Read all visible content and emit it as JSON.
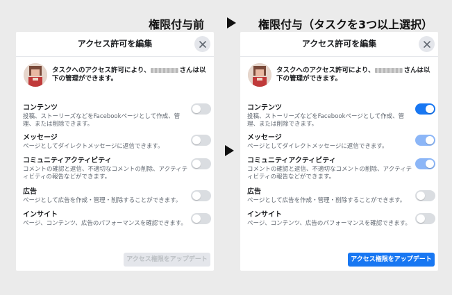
{
  "headings": {
    "before": "権限付与前",
    "after": "権限付与（タスクを3つ以上選択）"
  },
  "dialog_before": {
    "title": "アクセス許可を編集",
    "intro_prefix": "タスクへのアクセス許可により、",
    "intro_suffix": "さんは以下の管理ができます。",
    "permissions": [
      {
        "label": "コンテンツ",
        "desc": "投稿、ストーリーズなどをFacebookページとして作成、管理、または削除できます。",
        "state": "off"
      },
      {
        "label": "メッセージ",
        "desc": "ページとしてダイレクトメッセージに返信できます。",
        "state": "off"
      },
      {
        "label": "コミュニティアクティビティ",
        "desc": "コメントの確認と返信、不適切なコメントの削除、アクティティビティの報告などができます。",
        "state": "off"
      },
      {
        "label": "広告",
        "desc": "ページとして広告を作成・管理・削除することができます。",
        "state": "off"
      },
      {
        "label": "インサイト",
        "desc": "ページ、コンテンツ、広告のパフォーマンスを確認できます。",
        "state": "off"
      }
    ],
    "update_button": "アクセス権限をアップデート",
    "update_enabled": false
  },
  "dialog_after": {
    "title": "アクセス許可を編集",
    "intro_prefix": "タスクへのアクセス許可により、",
    "intro_suffix": "さんは以下の管理ができます。",
    "permissions": [
      {
        "label": "コンテンツ",
        "desc": "投稿、ストーリーズなどをFacebookページとして作成、管理、または削除できます。",
        "state": "on"
      },
      {
        "label": "メッセージ",
        "desc": "ページとしてダイレクトメッセージに返信できます。",
        "state": "on-dim"
      },
      {
        "label": "コミュニティアクティビティ",
        "desc": "コメントの確認と返信、不適切なコメントの削除、アクティティビティの報告などができます。",
        "state": "on-dim"
      },
      {
        "label": "広告",
        "desc": "ページとして広告を作成・管理・削除することができます。",
        "state": "off"
      },
      {
        "label": "インサイト",
        "desc": "ページ、コンテンツ、広告のパフォーマンスを確認できます。",
        "state": "off"
      }
    ],
    "update_button": "アクセス権限をアップデート",
    "update_enabled": true
  },
  "icons": {
    "close": "close-icon",
    "avatar": "avatar"
  },
  "colors": {
    "accent": "#1877f2",
    "accent_dim": "#8cb6f7",
    "toggle_off": "#dadde1",
    "background": "#ebebeb"
  }
}
